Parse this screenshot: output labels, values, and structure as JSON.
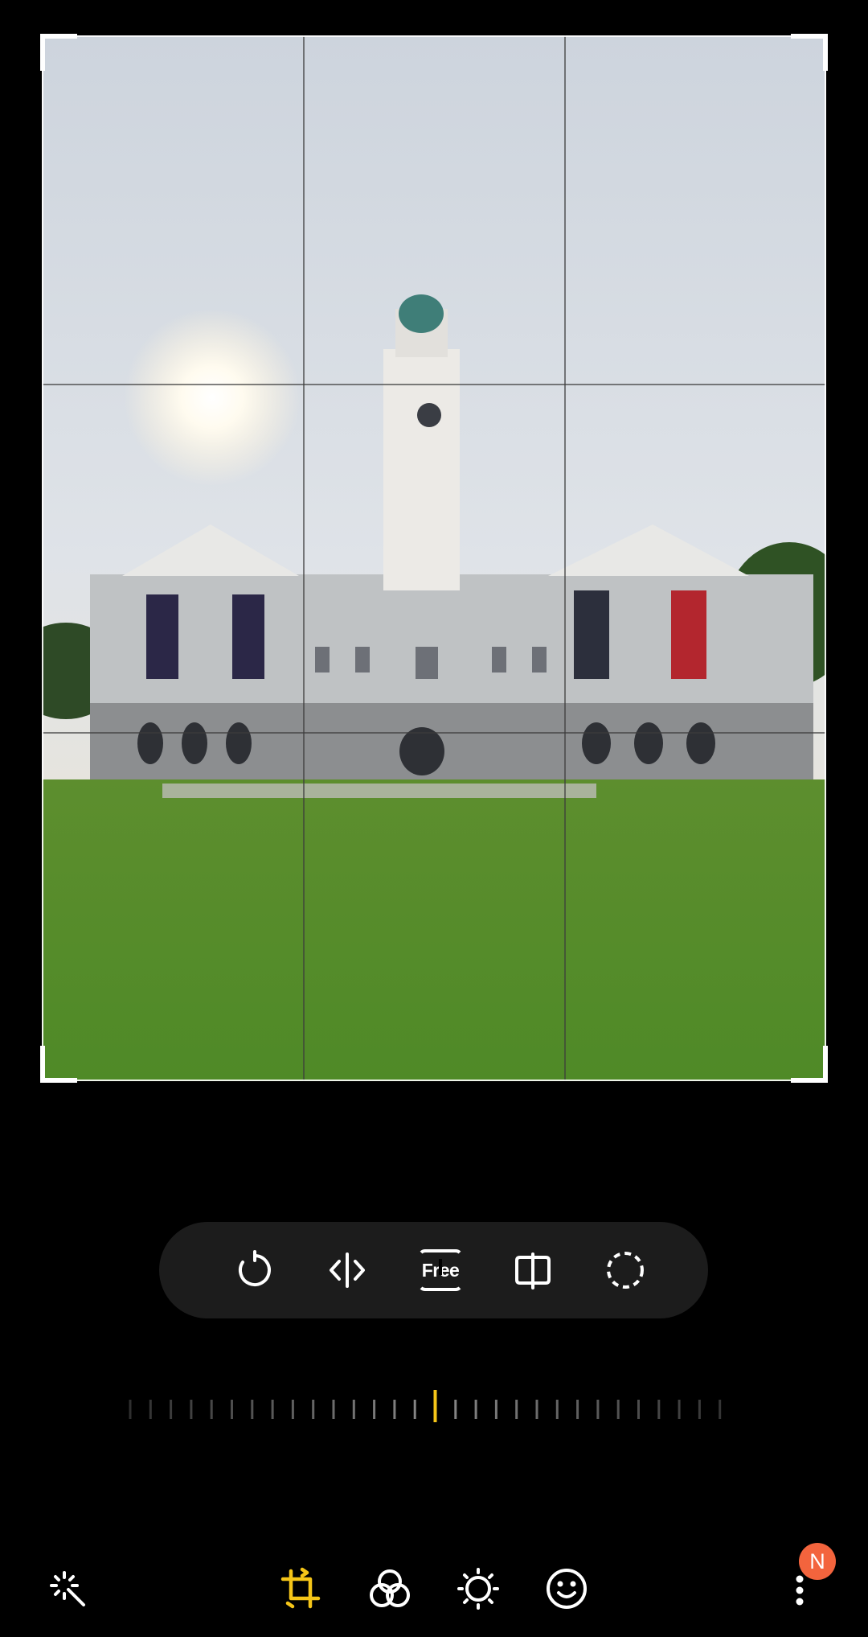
{
  "crop_toolbar": {
    "rotate_icon": "rotate-icon",
    "flip_icon": "flip-horizontal-icon",
    "aspect_label": "Free",
    "perspective_icon": "perspective-icon",
    "lasso_icon": "lasso-icon"
  },
  "straighten_slider": {
    "value": 0
  },
  "bottom_nav": {
    "items": [
      {
        "name": "auto-enhance-icon",
        "active": false
      },
      {
        "name": "crop-rotate-icon",
        "active": true
      },
      {
        "name": "filters-icon",
        "active": false
      },
      {
        "name": "brightness-icon",
        "active": false
      },
      {
        "name": "sticker-icon",
        "active": false
      },
      {
        "name": "more-options-icon",
        "active": false
      }
    ],
    "badge": "N"
  },
  "colors": {
    "accent": "#f5c518",
    "background": "#000000",
    "toolbar_bg": "#1c1c1c",
    "badge": "#f3643d",
    "icon": "#ffffff"
  }
}
